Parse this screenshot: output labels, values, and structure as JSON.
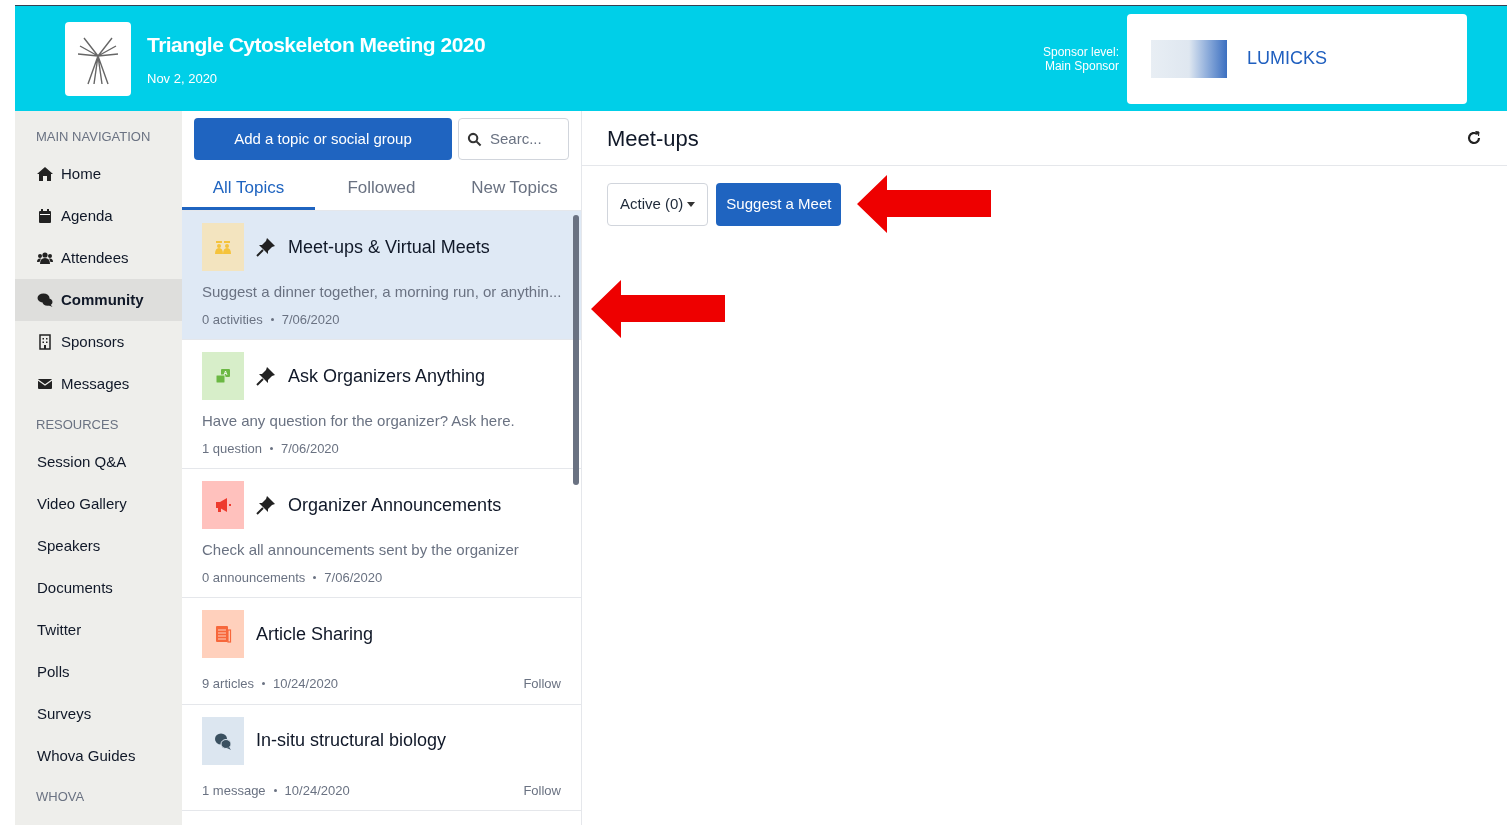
{
  "header": {
    "title": "Triangle Cytoskeleton Meeting 2020",
    "date": "Nov 2, 2020",
    "sponsor_label": "Sponsor level:",
    "sponsor_level": "Main Sponsor",
    "sponsor_name": "LUMICKS"
  },
  "sidebar": {
    "sections": [
      {
        "heading": "MAIN NAVIGATION",
        "items": [
          {
            "label": "Home",
            "selected": false
          },
          {
            "label": "Agenda",
            "selected": false
          },
          {
            "label": "Attendees",
            "selected": false
          },
          {
            "label": "Community",
            "selected": true
          },
          {
            "label": "Sponsors",
            "selected": false
          },
          {
            "label": "Messages",
            "selected": false
          }
        ]
      },
      {
        "heading": "RESOURCES",
        "items": [
          {
            "label": "Session Q&A",
            "selected": false
          },
          {
            "label": "Video Gallery",
            "selected": false
          },
          {
            "label": "Speakers",
            "selected": false
          },
          {
            "label": "Documents",
            "selected": false
          },
          {
            "label": "Twitter",
            "selected": false
          },
          {
            "label": "Polls",
            "selected": false
          },
          {
            "label": "Surveys",
            "selected": false
          },
          {
            "label": "Whova Guides",
            "selected": false
          }
        ]
      },
      {
        "heading": "WHOVA"
      }
    ]
  },
  "topics_panel": {
    "add_button": "Add a topic or social group",
    "search": {
      "placeholder": "Searc..."
    },
    "tabs": [
      {
        "label": "All Topics",
        "selected": true
      },
      {
        "label": "Followed",
        "selected": false
      },
      {
        "label": "New Topics",
        "selected": false
      }
    ],
    "topics": [
      {
        "kind": "meetup",
        "title": "Meet-ups & Virtual Meets",
        "pinned": true,
        "description": "Suggest a dinner together, a morning run, or anythin...",
        "count": "0 activities",
        "date": "7/06/2020",
        "selected": true
      },
      {
        "kind": "qa",
        "title": "Ask Organizers Anything",
        "pinned": true,
        "description": "Have any question for the organizer? Ask here.",
        "count": "1 question",
        "date": "7/06/2020",
        "selected": false
      },
      {
        "kind": "announcement",
        "title": "Organizer Announcements",
        "pinned": true,
        "description": "Check all announcements sent by the organizer",
        "count": "0 announcements",
        "date": "7/06/2020",
        "selected": false
      },
      {
        "kind": "article",
        "title": "Article Sharing",
        "pinned": false,
        "count": "9 articles",
        "date": "10/24/2020",
        "follow": "Follow",
        "selected": false
      },
      {
        "kind": "chat",
        "title": "In-situ structural biology",
        "pinned": false,
        "count": "1 message",
        "date": "10/24/2020",
        "follow": "Follow",
        "selected": false
      }
    ]
  },
  "main": {
    "title": "Meet-ups",
    "filter": "Active (0)",
    "suggest_button": "Suggest a Meet"
  }
}
